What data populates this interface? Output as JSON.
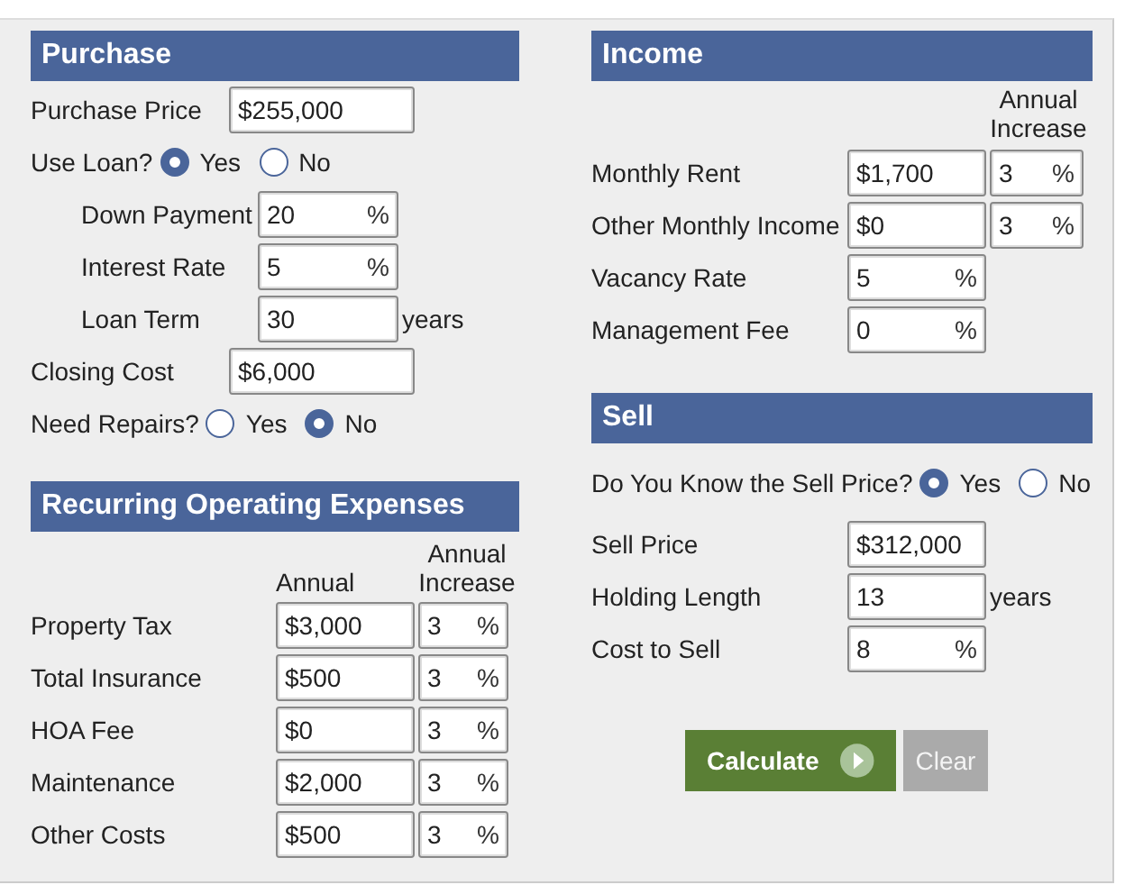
{
  "purchase": {
    "title": "Purchase",
    "rows": [
      {
        "kind": "field",
        "label": "Purchase Price",
        "value": "$255,000"
      },
      {
        "kind": "radio",
        "label": "Use Loan?",
        "options": [
          {
            "label": "Yes",
            "selected": true
          },
          {
            "label": "No",
            "selected": false
          }
        ],
        "children": [
          {
            "label": "Down Payment",
            "value": "20",
            "unit": "%"
          },
          {
            "label": "Interest Rate",
            "value": "5",
            "unit": "%"
          },
          {
            "label": "Loan Term",
            "value": "30",
            "after": "years"
          }
        ]
      },
      {
        "kind": "field",
        "label": "Closing Cost",
        "value": "$6,000"
      },
      {
        "kind": "radio",
        "label": "Need Repairs?",
        "options": [
          {
            "label": "Yes",
            "selected": false
          },
          {
            "label": "No",
            "selected": true
          }
        ]
      }
    ]
  },
  "expenses": {
    "title": "Recurring Operating Expenses",
    "annual_header": "Annual",
    "increase_header": "Annual Increase",
    "rows": [
      {
        "label": "Property Tax",
        "value": "$3,000",
        "increase": "3",
        "unit": "%"
      },
      {
        "label": "Total Insurance",
        "value": "$500",
        "increase": "3",
        "unit": "%"
      },
      {
        "label": "HOA Fee",
        "value": "$0",
        "increase": "3",
        "unit": "%"
      },
      {
        "label": "Maintenance",
        "value": "$2,000",
        "increase": "3",
        "unit": "%"
      },
      {
        "label": "Other Costs",
        "value": "$500",
        "increase": "3",
        "unit": "%"
      }
    ]
  },
  "income": {
    "title": "Income",
    "increase_header": "Annual Increase",
    "rows": [
      {
        "label": "Monthly Rent",
        "value": "$1,700",
        "increase": "3",
        "increase_unit": "%"
      },
      {
        "label": "Other Monthly Income",
        "value": "$0",
        "increase": "3",
        "increase_unit": "%"
      },
      {
        "label": "Vacancy Rate",
        "value": "5",
        "unit": "%"
      },
      {
        "label": "Management Fee",
        "value": "0",
        "unit": "%"
      }
    ]
  },
  "sell": {
    "title": "Sell",
    "question": {
      "label": "Do You Know the Sell Price?",
      "options": [
        {
          "label": "Yes",
          "selected": true
        },
        {
          "label": "No",
          "selected": false
        }
      ]
    },
    "rows": [
      {
        "label": "Sell Price",
        "value": "$312,000"
      },
      {
        "label": "Holding Length",
        "value": "13",
        "after": "years"
      },
      {
        "label": "Cost to Sell",
        "value": "8",
        "unit": "%"
      }
    ],
    "buttons": [
      {
        "label": "Calculate",
        "kind": "primary"
      },
      {
        "label": "Clear",
        "kind": "secondary"
      }
    ]
  }
}
